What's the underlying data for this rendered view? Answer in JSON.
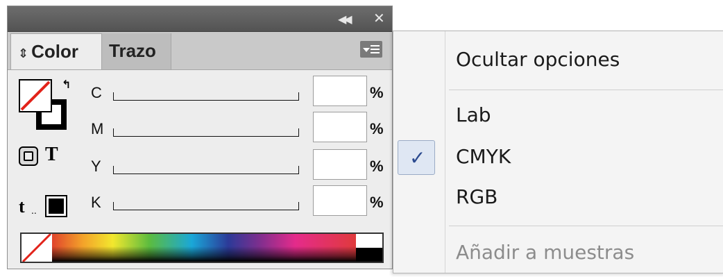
{
  "panel": {
    "titlebar": {
      "collapse_icon": "double-chevron-left-icon",
      "close_icon": "close-icon"
    },
    "tabs": [
      {
        "label": "Color",
        "active": true
      },
      {
        "label": "Trazo",
        "active": false
      }
    ],
    "menu_button_icon": "panel-menu-icon",
    "sliders": [
      {
        "label": "C",
        "value": "",
        "unit": "%"
      },
      {
        "label": "M",
        "value": "",
        "unit": "%"
      },
      {
        "label": "Y",
        "value": "",
        "unit": "%"
      },
      {
        "label": "K",
        "value": "",
        "unit": "%"
      }
    ],
    "swatches": {
      "fill": "none",
      "stroke": "#000000",
      "apply_color": "#000000"
    }
  },
  "menu": {
    "items": [
      {
        "label": "Ocultar opciones",
        "checked": false,
        "enabled": true
      },
      {
        "label": "Lab",
        "checked": false,
        "enabled": true
      },
      {
        "label": "CMYK",
        "checked": true,
        "enabled": true
      },
      {
        "label": "RGB",
        "checked": false,
        "enabled": true
      },
      {
        "label": "Añadir a muestras",
        "checked": false,
        "enabled": false
      }
    ],
    "check_glyph": "✓"
  },
  "colors": {
    "none_slash": "#e2231a",
    "check": "#2b4a8f",
    "titlebar": "#5e5e5e"
  }
}
